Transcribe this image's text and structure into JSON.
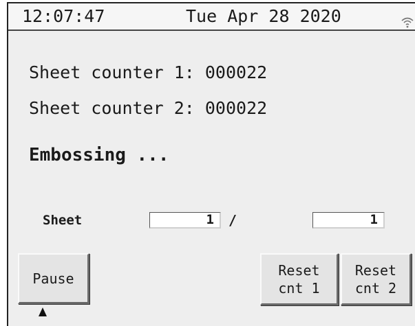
{
  "status_bar": {
    "time": "12:07:47",
    "date": "Tue Apr 28 2020",
    "wifi_icon": "wifi-icon"
  },
  "counters": {
    "counter1": "Sheet counter 1: 000022",
    "counter2": "Sheet counter 2: 000022"
  },
  "status": "Embossing ...",
  "sheet": {
    "label": "Sheet",
    "current": "1",
    "separator": "/",
    "total": "1"
  },
  "buttons": {
    "pause": "Pause",
    "reset1_line1": "Reset",
    "reset1_line2": "cnt 1",
    "reset2_line1": "Reset",
    "reset2_line2": "cnt 2"
  },
  "colors": {
    "background": "#eeeeee",
    "text": "#1a1a1a",
    "field": "#ffffff"
  }
}
